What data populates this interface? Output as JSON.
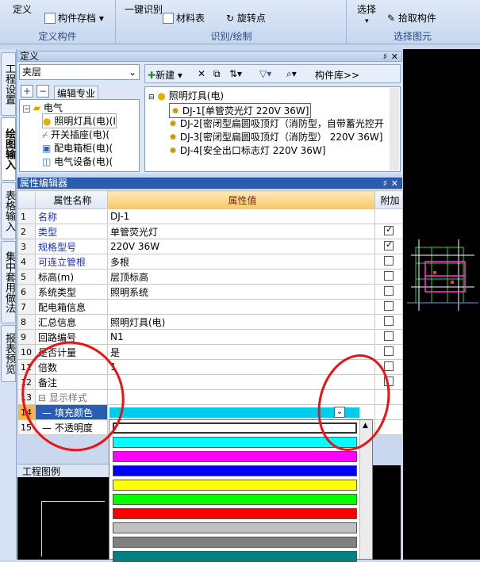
{
  "ribbon": {
    "define_label": "定义",
    "component_save_label": "构件存档",
    "group1_caption": "定义构件",
    "one_key_identify_label": "一键识别",
    "material_table_label": "材料表",
    "rotate_point_label": "旋转点",
    "group2_caption": "识别/绘制",
    "select_label": "选择",
    "pick_component_label": "拾取构件",
    "group3_caption": "选择图元"
  },
  "vtabs": [
    "工程设置",
    "绘图输入",
    "表格输入",
    "集中套用做法",
    "报表预览"
  ],
  "definition": {
    "title": "定义",
    "floor_select": "夹层",
    "edit_pro_label": "编辑专业",
    "tree": [
      {
        "label": "电气",
        "indent": 0
      },
      {
        "label": "照明灯具(电)(I",
        "indent": 1
      },
      {
        "label": "开关插座(电)(",
        "indent": 1
      },
      {
        "label": "配电箱柜(电)(",
        "indent": 1
      },
      {
        "label": "电气设备(电)(",
        "indent": 1
      }
    ],
    "toolbar": {
      "new_label": "新建",
      "library_label": "构件库>>"
    },
    "list_root": "照明灯具(电)",
    "list_items": [
      "DJ-1[单管荧光灯 220V 36W]",
      "DJ-2[密闭型扁圆吸顶灯（消防型，自带蓄光控开",
      "DJ-3[密闭型扁圆吸顶灯（消防型） 220V 36W]",
      "DJ-4[安全出口标志灯 220V 36W]"
    ]
  },
  "props": {
    "title": "属性编辑器",
    "col_name": "属性名称",
    "col_value": "属性值",
    "col_extra": "附加",
    "rows": [
      {
        "no": "1",
        "name": "名称",
        "value": "DJ-1",
        "blue": true,
        "check": null
      },
      {
        "no": "2",
        "name": "类型",
        "value": "单管荧光灯",
        "blue": true,
        "check": true
      },
      {
        "no": "3",
        "name": "规格型号",
        "value": "220V 36W",
        "blue": true,
        "check": true
      },
      {
        "no": "4",
        "name": "可连立管根",
        "value": "多根",
        "blue": true,
        "check": false
      },
      {
        "no": "5",
        "name": "标高(m)",
        "value": "层顶标高",
        "blue": false,
        "check": false
      },
      {
        "no": "6",
        "name": "系统类型",
        "value": "照明系统",
        "blue": false,
        "check": false
      },
      {
        "no": "7",
        "name": "配电箱信息",
        "value": "",
        "blue": false,
        "check": false
      },
      {
        "no": "8",
        "name": "汇总信息",
        "value": "照明灯具(电)",
        "blue": false,
        "check": false
      },
      {
        "no": "9",
        "name": "回路编号",
        "value": "N1",
        "blue": false,
        "check": false
      },
      {
        "no": "10",
        "name": "是否计量",
        "value": "是",
        "blue": false,
        "check": false
      },
      {
        "no": "11",
        "name": "倍数",
        "value": "1",
        "blue": false,
        "check": false
      },
      {
        "no": "12",
        "name": "备注",
        "value": "",
        "blue": false,
        "check": false
      },
      {
        "no": "13",
        "name": "显示样式",
        "value": "",
        "blue": false,
        "check": null
      },
      {
        "no": "14",
        "name": "填充颜色",
        "value": "",
        "blue": false,
        "check": null
      },
      {
        "no": "15",
        "name": "不透明度",
        "value": "",
        "blue": false,
        "check": null
      }
    ]
  },
  "legend_title": "工程图例",
  "colors": [
    "#ffffff",
    "#00ffff",
    "#ff00ff",
    "#0000ff",
    "#ffff00",
    "#00ff00",
    "#ff0000",
    "#c0c0c0",
    "#808080",
    "#008080"
  ],
  "selected_fill": "#00ccee"
}
